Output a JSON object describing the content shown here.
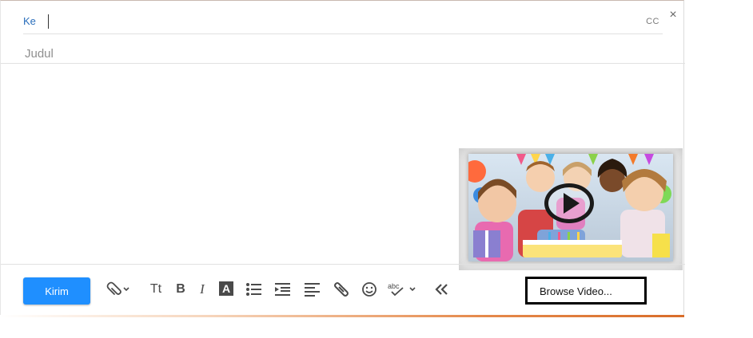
{
  "compose": {
    "to_label": "Ke",
    "cc_label": "CC",
    "close_symbol": "×",
    "subject_placeholder": "Judul",
    "send_label": "Kirim"
  },
  "video": {
    "icon": "play-icon"
  },
  "toolbar": {
    "icons": [
      "paperclip-icon",
      "text-size-icon",
      "bold-icon",
      "italic-icon",
      "text-color-icon",
      "bullet-list-icon",
      "indent-icon",
      "align-left-icon",
      "link-icon",
      "emoji-icon",
      "spellcheck-icon",
      "collapse-icon"
    ],
    "text_size": "Tt",
    "bold": "B",
    "italic": "I",
    "text_color": "A",
    "spellcheck": "abc"
  },
  "browse": {
    "label": "Browse Video..."
  },
  "colors": {
    "send_button": "#1f8fff",
    "to_label": "#2a6ebb",
    "bottom_accent": "#e58a4c"
  }
}
